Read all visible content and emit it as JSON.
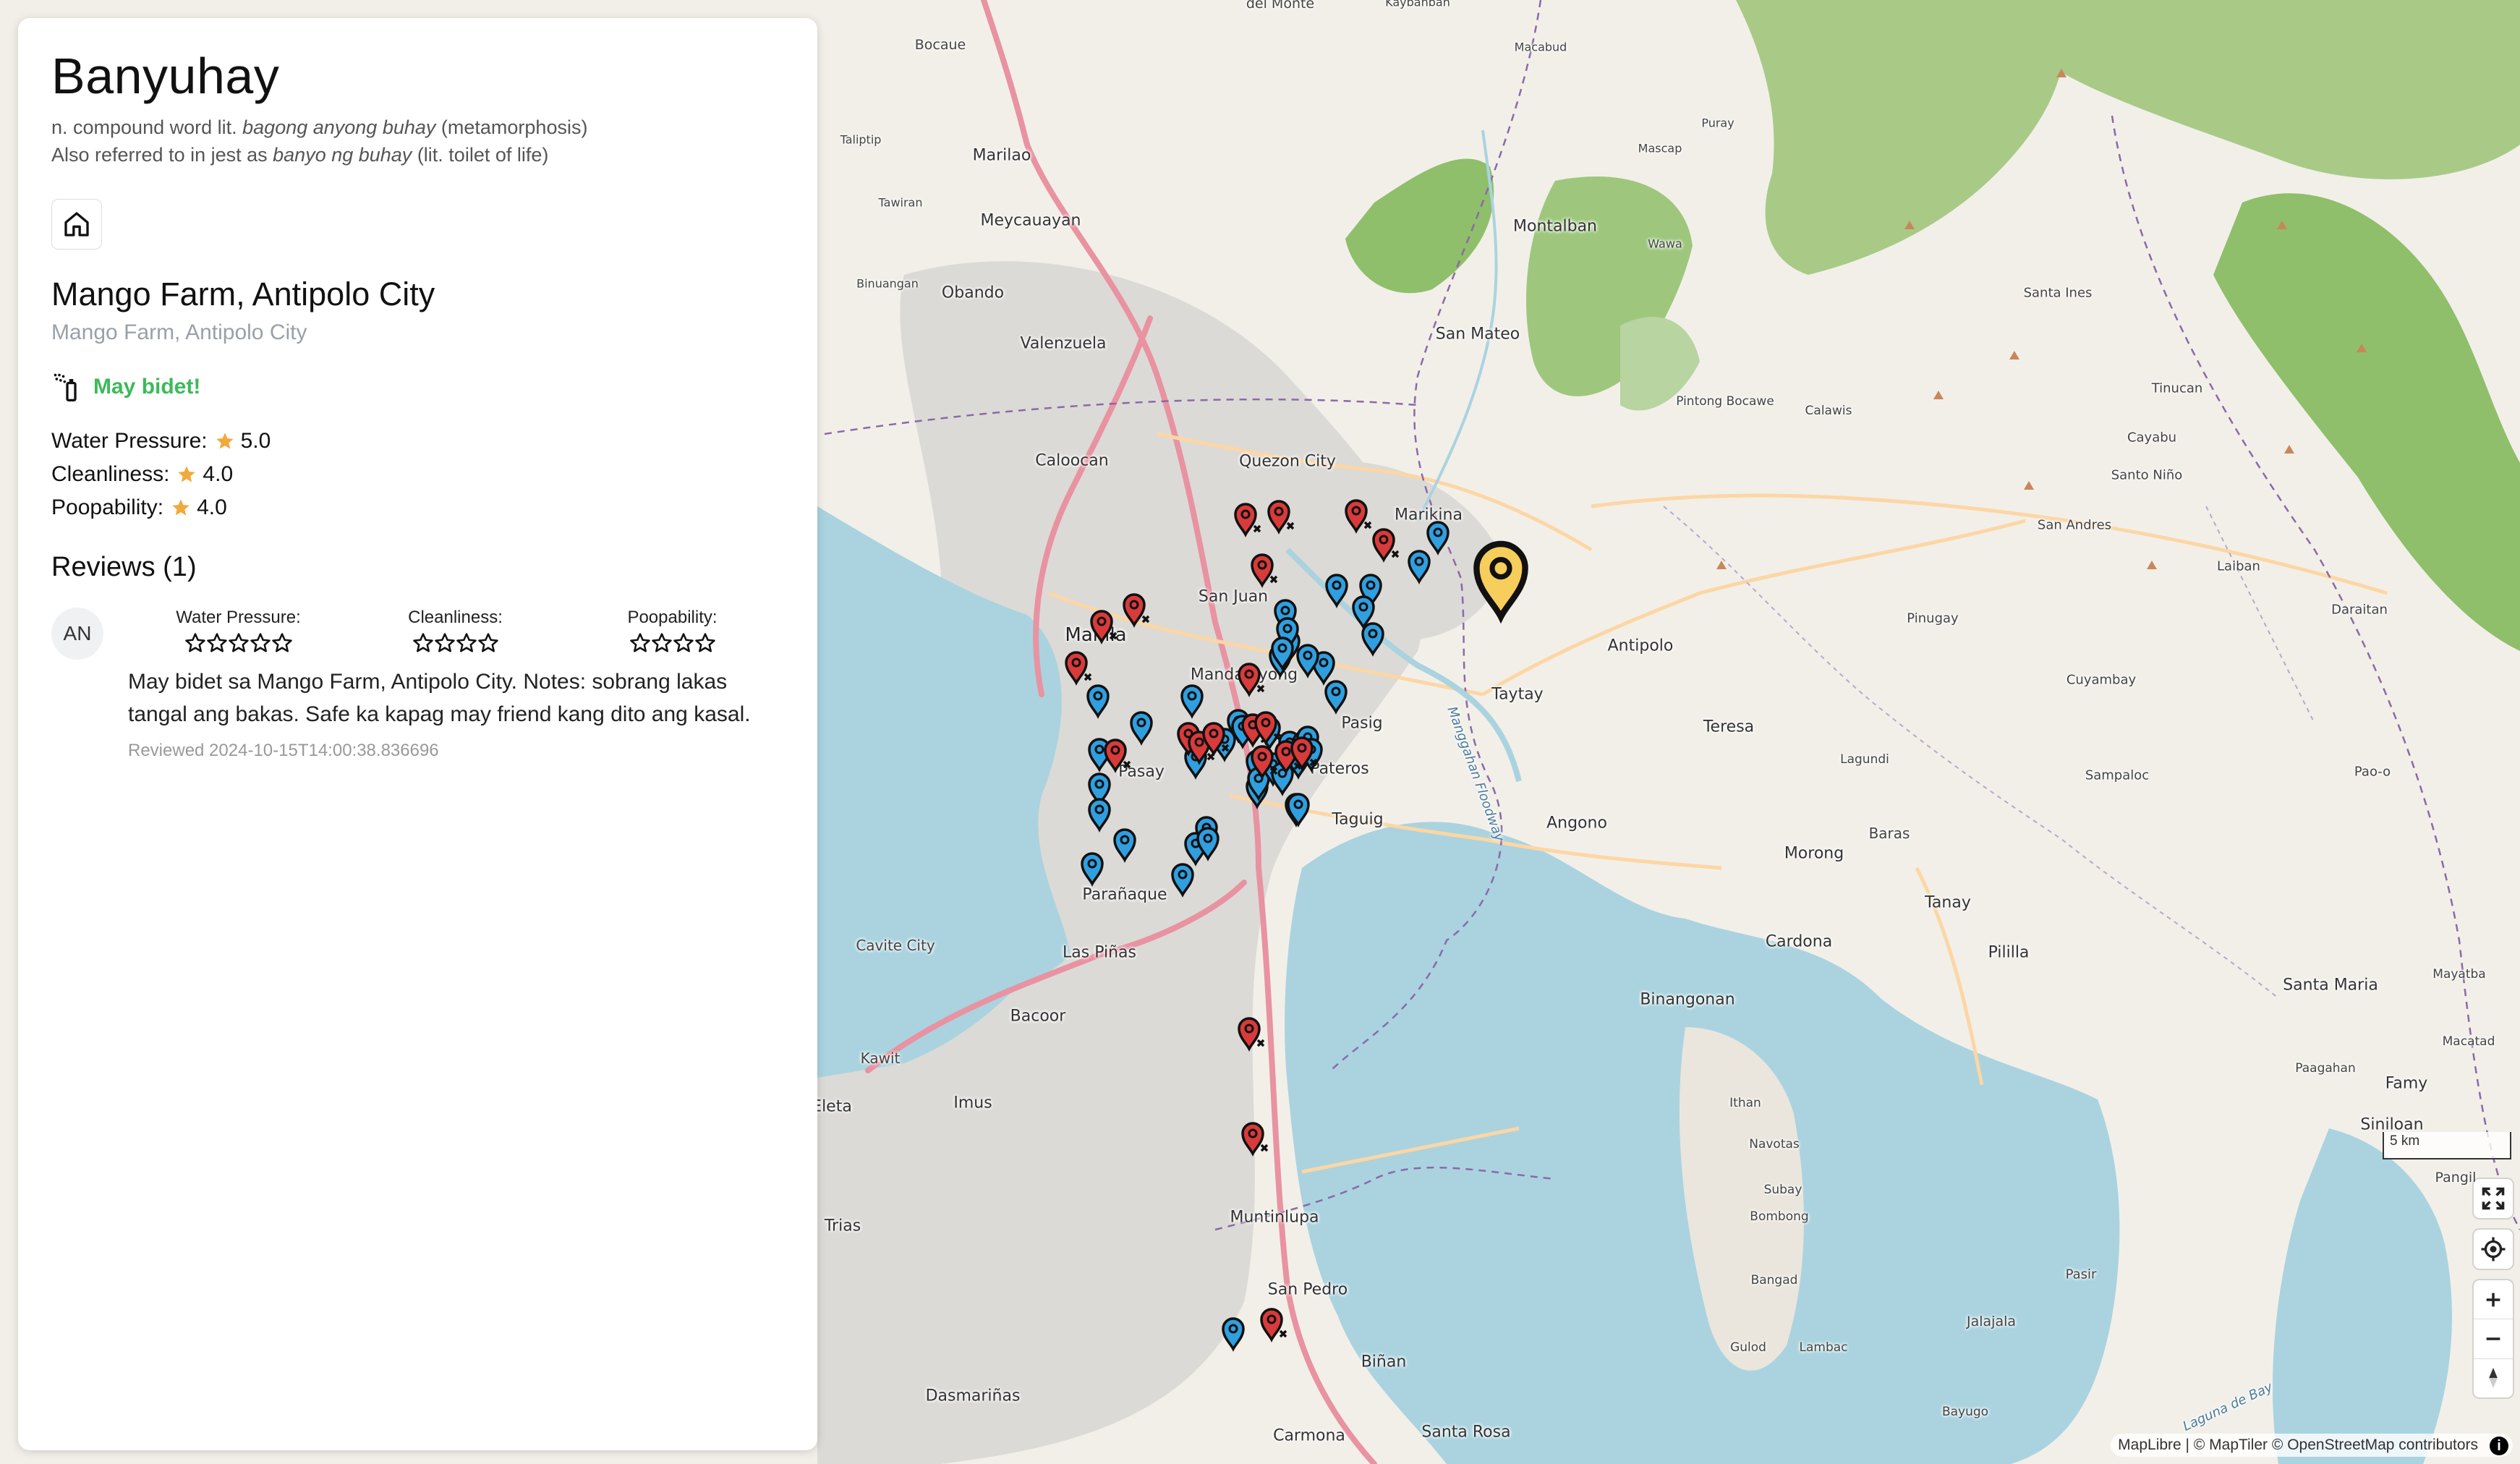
{
  "app": {
    "title": "Banyuhay",
    "definition_prefix": "n. compound word lit. ",
    "definition_italic": "bagong anyong buhay",
    "definition_suffix": " (metamorphosis)",
    "alias_prefix": "Also referred to in jest as ",
    "alias_italic": "banyo ng buhay",
    "alias_suffix": " (lit. toilet of life)"
  },
  "location": {
    "name": "Mango Farm, Antipolo City",
    "subtitle": "Mango Farm, Antipolo City",
    "bidet_label": "May bidet!",
    "ratings": [
      {
        "label": "Water Pressure:",
        "value": "5.0"
      },
      {
        "label": "Cleanliness:",
        "value": "4.0"
      },
      {
        "label": "Poopability:",
        "value": "4.0"
      }
    ]
  },
  "reviews": {
    "heading": "Reviews (1)",
    "items": [
      {
        "avatar": "AN",
        "categories": [
          {
            "label": "Water Pressure:",
            "stars": 5
          },
          {
            "label": "Cleanliness:",
            "stars": 4
          },
          {
            "label": "Poopability:",
            "stars": 4
          }
        ],
        "text": "May bidet sa Mango Farm, Antipolo City. Notes: sobrang lakas tangal ang bakas. Safe ka kapag may friend kang dito ang kasal.",
        "date": "Reviewed 2024-10-15T14:00:38.836696"
      }
    ]
  },
  "map": {
    "attribution": "MapLibre | © MapTiler © OpenStreetMap contributors",
    "scale_label": "5 km",
    "colors": {
      "bidet_pin": "#2f9fe0",
      "no_bidet_pin": "#d93a3a",
      "selected_pin": "#f7cd5c",
      "water": "#aad3df",
      "forest": "#8fbf6a"
    },
    "labels": [
      {
        "text": "Bocaue"
      },
      {
        "text": "del Monte"
      },
      {
        "text": "Kaybanban"
      },
      {
        "text": "Macabud"
      },
      {
        "text": "Puray"
      },
      {
        "text": "Mascap"
      },
      {
        "text": "Taliptip"
      },
      {
        "text": "Marilao"
      },
      {
        "text": "Tawiran"
      },
      {
        "text": "Meycauayan"
      },
      {
        "text": "Montalban"
      },
      {
        "text": "Wawa"
      },
      {
        "text": "Binuangan"
      },
      {
        "text": "Obando"
      },
      {
        "text": "Santa Ines"
      },
      {
        "text": "Valenzuela"
      },
      {
        "text": "San Mateo"
      },
      {
        "text": "Tinucan"
      },
      {
        "text": "Pintong Bocawe"
      },
      {
        "text": "Calawis"
      },
      {
        "text": "Cayabu"
      },
      {
        "text": "Caloocan"
      },
      {
        "text": "Quezon City"
      },
      {
        "text": "Santo Niño"
      },
      {
        "text": "San Andres"
      },
      {
        "text": "Marikina"
      },
      {
        "text": "Laiban"
      },
      {
        "text": "Daraitan"
      },
      {
        "text": "San Juan"
      },
      {
        "text": "Pinugay"
      },
      {
        "text": "Manila"
      },
      {
        "text": "Antipolo"
      },
      {
        "text": "Mandaluyong"
      },
      {
        "text": "Taytay"
      },
      {
        "text": "Cuyambay"
      },
      {
        "text": "Pasig"
      },
      {
        "text": "Teresa"
      },
      {
        "text": "Pasay"
      },
      {
        "text": "Pateros"
      },
      {
        "text": "Sampaloc"
      },
      {
        "text": "Pao-o"
      },
      {
        "text": "Lagundi"
      },
      {
        "text": "Taguig"
      },
      {
        "text": "Angono"
      },
      {
        "text": "Baras"
      },
      {
        "text": "Morong"
      },
      {
        "text": "Parañaque"
      },
      {
        "text": "Tanay"
      },
      {
        "text": "Cavite City"
      },
      {
        "text": "Las Piñas"
      },
      {
        "text": "Cardona"
      },
      {
        "text": "Pililla"
      },
      {
        "text": "Santa Maria"
      },
      {
        "text": "Mayatba"
      },
      {
        "text": "Bacoor"
      },
      {
        "text": "Binangonan"
      },
      {
        "text": "Kawit"
      },
      {
        "text": "Paagahan"
      },
      {
        "text": "Macatad"
      },
      {
        "text": "Famy"
      },
      {
        "text": "Imus"
      },
      {
        "text": "Ithan"
      },
      {
        "text": "Siniloan"
      },
      {
        "text": "Navotas"
      },
      {
        "text": "Subay"
      },
      {
        "text": "Bombong"
      },
      {
        "text": "Muntinlupa"
      },
      {
        "text": "Pangil"
      },
      {
        "text": "Bangad"
      },
      {
        "text": "Pasir"
      },
      {
        "text": "San Pedro"
      },
      {
        "text": "Jalajala"
      },
      {
        "text": "Gulod"
      },
      {
        "text": "Lambac"
      },
      {
        "text": "Biñan"
      },
      {
        "text": "Dasmariñas"
      },
      {
        "text": "Bayugo"
      },
      {
        "text": "Carmona"
      },
      {
        "text": "Santa Rosa"
      },
      {
        "text": "Eleta"
      },
      {
        "text": "Trias"
      },
      {
        "text": "Manggahan Floodway"
      },
      {
        "text": "Laguna de Bay"
      }
    ]
  }
}
